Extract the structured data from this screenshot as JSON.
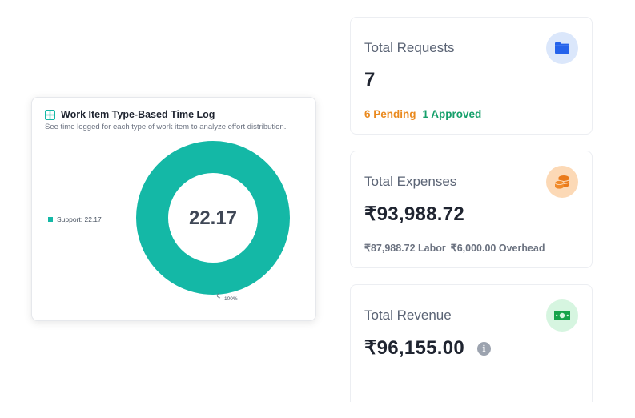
{
  "chart_card": {
    "title": "Work Item Type-Based Time Log",
    "subtitle": "See time logged for each type of work item to analyze effort distribution.",
    "icon": "grid-icon",
    "accent_color": "#14b8a6"
  },
  "chart_data": {
    "type": "pie",
    "variant": "donut",
    "center_label": "22.17",
    "series": [
      {
        "name": "Support",
        "value": 22.17,
        "percent": 100,
        "color": "#14b8a6"
      }
    ],
    "legend_text": "Support: 22.17",
    "slice_labels": [
      "100%"
    ],
    "legend_placement": "left"
  },
  "cards": {
    "requests": {
      "label": "Total Requests",
      "value": "7",
      "icon": "folder-icon",
      "pending": "6 Pending",
      "approved": "1 Approved"
    },
    "expenses": {
      "label": "Total Expenses",
      "value": "₹93,988.72",
      "icon": "coins-icon",
      "labor": "₹87,988.72 Labor",
      "overhead": "₹6,000.00 Overhead"
    },
    "revenue": {
      "label": "Total Revenue",
      "value": "₹96,155.00",
      "icon": "cash-icon",
      "info_icon": "info-icon"
    }
  },
  "colors": {
    "pending": "#ea8a1f",
    "approved": "#16a06b",
    "blue_icon": "#2563eb",
    "orange_icon": "#ea7a1a",
    "green_icon": "#16a34a"
  }
}
